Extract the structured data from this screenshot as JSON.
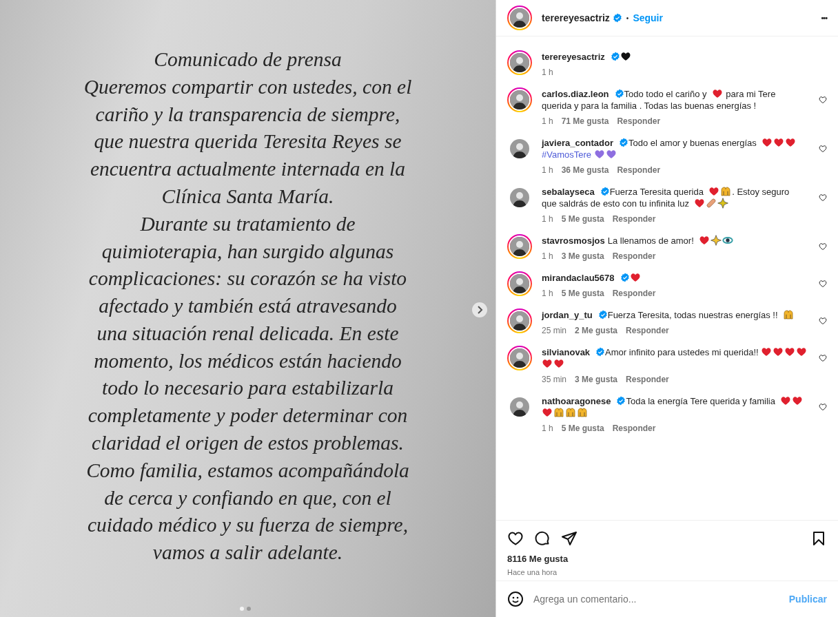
{
  "post": {
    "lines": [
      "Comunicado de prensa",
      "Queremos compartir con ustedes, con el",
      "cariño y la transparencia de siempre,",
      "que nuestra querida Teresita Reyes se",
      "encuentra actualmente internada en la",
      "Clínica Santa María.",
      "Durante su tratamiento de",
      "quimioterapia, han surgido algunas",
      "complicaciones: su corazón se ha visto",
      "afectado y también está atravesando",
      "una situación renal delicada. En este",
      "momento, los médicos están haciendo",
      "todo lo necesario para estabilizarla",
      "completamente y poder determinar con",
      "claridad el origen de estos problemas.",
      "Como familia, estamos acompañándola",
      "de cerca y confiando en que, con el",
      "cuidado médico y su fuerza de siempre,",
      "vamos a salir adelante."
    ],
    "slides": [
      {
        "selected": true
      },
      {
        "selected": false
      }
    ]
  },
  "header": {
    "username": "terereyesactriz",
    "verified": true,
    "story_ring": true,
    "separator": "•",
    "follow": "Seguir",
    "more": "•••"
  },
  "caption": {
    "username": "terereyesactriz",
    "verified": true,
    "story_ring": true,
    "parts": [
      {
        "kind": "heart",
        "color": "#111111"
      }
    ],
    "time": "1 h"
  },
  "comments": [
    {
      "username": "carlos.diaz.leon",
      "verified": true,
      "story_ring": true,
      "parts": [
        {
          "kind": "text",
          "text": "Todo todo el cariño y "
        },
        {
          "kind": "heart",
          "color": "#e0202e"
        },
        {
          "kind": "text",
          "text": " para mi Tere"
        },
        {
          "kind": "text",
          "text": "querida y para la familia . Todas las buenas energías !"
        }
      ],
      "time": "1 h",
      "likes": "71 Me gusta",
      "reply": "Responder"
    },
    {
      "username": "javiera_contador",
      "verified": true,
      "story_ring": false,
      "parts": [
        {
          "kind": "text",
          "text": "Todo el amor y buenas energías "
        },
        {
          "kind": "heart",
          "color": "#e0202e"
        },
        {
          "kind": "heart",
          "color": "#e0202e"
        },
        {
          "kind": "heart",
          "color": "#e0202e"
        },
        {
          "kind": "link",
          "text": "#VamosTere"
        },
        {
          "kind": "heart",
          "color": "#8e6fe0"
        },
        {
          "kind": "heart",
          "color": "#8e6fe0"
        }
      ],
      "time": "1 h",
      "likes": "36 Me gusta",
      "reply": "Responder"
    },
    {
      "username": "sebalayseca",
      "verified": true,
      "story_ring": false,
      "parts": [
        {
          "kind": "text",
          "text": "Fuerza Teresita querida "
        },
        {
          "kind": "heart",
          "color": "#e0202e"
        },
        {
          "kind": "hands",
          "color": "#f2b52b"
        },
        {
          "kind": "text",
          "text": ". Estoy seguro"
        },
        {
          "kind": "text",
          "text": "que saldrás de esto con tu infinita luz "
        },
        {
          "kind": "heart",
          "color": "#e0202e"
        },
        {
          "kind": "bandage",
          "color": "#e8a27a"
        },
        {
          "kind": "star",
          "color": "#d9c21a"
        }
      ],
      "time": "1 h",
      "likes": "5 Me gusta",
      "reply": "Responder"
    },
    {
      "username": "stavrosmosjos",
      "verified": false,
      "story_ring": true,
      "parts": [
        {
          "kind": "text",
          "text": "La llenamos de amor! "
        },
        {
          "kind": "heart",
          "color": "#e0202e"
        },
        {
          "kind": "star",
          "color": "#f2c230"
        },
        {
          "kind": "ring",
          "color": "#3aa0a8"
        }
      ],
      "time": "1 h",
      "likes": "3 Me gusta",
      "reply": "Responder"
    },
    {
      "username": "mirandaclau5678",
      "verified": true,
      "story_ring": true,
      "parts": [
        {
          "kind": "heart",
          "color": "#e0202e"
        }
      ],
      "time": "1 h",
      "likes": "5 Me gusta",
      "reply": "Responder"
    },
    {
      "username": "jordan_y_tu",
      "verified": true,
      "story_ring": true,
      "parts": [
        {
          "kind": "text",
          "text": "Fuerza Teresita, todas nuestras energías !! "
        },
        {
          "kind": "hands",
          "color": "#f2b52b"
        }
      ],
      "time": "25 min",
      "likes": "2 Me gusta",
      "reply": "Responder"
    },
    {
      "username": "silvianovak",
      "verified": true,
      "story_ring": true,
      "parts": [
        {
          "kind": "text",
          "text": "Amor infinito para ustedes mi querida!!"
        },
        {
          "kind": "heart",
          "color": "#e0202e"
        },
        {
          "kind": "heart",
          "color": "#e0202e"
        },
        {
          "kind": "heart",
          "color": "#e0202e"
        },
        {
          "kind": "heart",
          "color": "#e0202e"
        },
        {
          "kind": "heart",
          "color": "#e0202e"
        },
        {
          "kind": "heart",
          "color": "#e0202e"
        }
      ],
      "time": "35 min",
      "likes": "3 Me gusta",
      "reply": "Responder"
    },
    {
      "username": "nathoaragonese",
      "verified": true,
      "story_ring": false,
      "parts": [
        {
          "kind": "text",
          "text": "Toda la energía Tere querida y familia "
        },
        {
          "kind": "heart",
          "color": "#e0202e"
        },
        {
          "kind": "heart",
          "color": "#e0202e"
        },
        {
          "kind": "heart",
          "color": "#e0202e"
        },
        {
          "kind": "hands",
          "color": "#f2b52b"
        },
        {
          "kind": "hands",
          "color": "#f2b52b"
        },
        {
          "kind": "hands",
          "color": "#f2b52b"
        }
      ],
      "time": "1 h",
      "likes": "5 Me gusta",
      "reply": "Responder"
    }
  ],
  "footer": {
    "likes": "8116 Me gusta",
    "time": "Hace una hora",
    "comment_placeholder": "Agrega un comentario...",
    "publish": "Publicar"
  }
}
